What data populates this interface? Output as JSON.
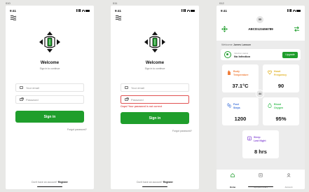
{
  "frames": {
    "f1": "010",
    "f2": "011",
    "f3": "012"
  },
  "status": {
    "time": "9:41"
  },
  "login": {
    "title": "Welcome",
    "subtitle": "Sign in to continue",
    "email_placeholder": "Your email",
    "password_placeholder": "Password",
    "signin_label": "Sign in",
    "forgot_label": "Forgot password?",
    "no_account_text": "Don't have an account?",
    "register_label": "Register"
  },
  "login_error": {
    "title": "Welcome",
    "subtitle": "Sign in to continue",
    "email_placeholder": "Your email",
    "password_placeholder": "Password",
    "error_message": "Oops! Your password is not correct",
    "signin_label": "Sign in",
    "forgot_label": "Forgot password?",
    "no_account_text": "Don't have an account?",
    "register_label": "Register"
  },
  "dashboard": {
    "device_id": "ABCD123456789",
    "welcome_prefix": "Welcome",
    "user_name": "James Lawson",
    "infection_label": "Infection status",
    "infection_value": "No Infection",
    "upgrade_label": "Upgrade",
    "badges": {
      "top": "55",
      "middle": "44"
    },
    "metrics": [
      {
        "label_line1": "Body",
        "label_line2": "Temperature",
        "value": "37.1°C",
        "color": "#f07f3c"
      },
      {
        "label_line1": "Heart",
        "label_line2": "Frequency",
        "value": "90",
        "color": "#e0b01f"
      },
      {
        "label_line1": "Foot",
        "label_line2": "Steps",
        "value": "1200",
        "color": "#3a6fd8"
      },
      {
        "label_line1": "Blood",
        "label_line2": "Oxygen",
        "value": "95%",
        "color": "#3bbf55"
      },
      {
        "label_line1": "Sleep",
        "label_line2": "Last Night",
        "value": "8 hrs",
        "color": "#8a4fd6"
      }
    ],
    "tabs": [
      {
        "label": "Home",
        "icon": "home-icon",
        "active": true
      },
      {
        "label": "Symptom diary",
        "icon": "diary-icon",
        "active": false
      },
      {
        "label": "Account",
        "icon": "account-icon",
        "active": false
      }
    ]
  },
  "colors": {
    "brand_green": "#1f9e2c",
    "error_red": "#e15252"
  }
}
